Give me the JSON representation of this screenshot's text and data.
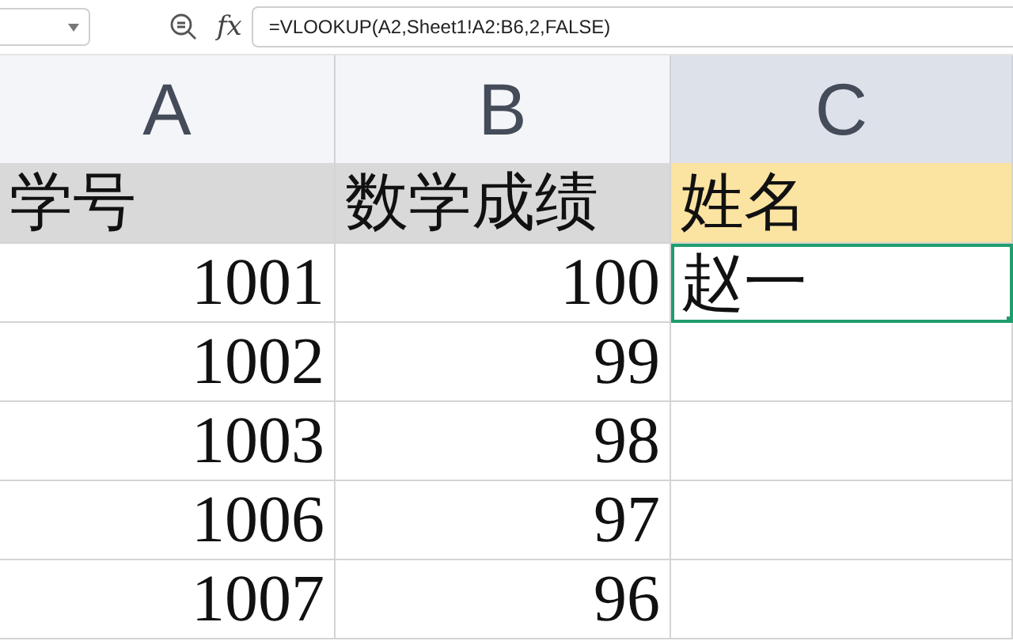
{
  "formula_bar": {
    "function_label": "fx",
    "formula": "=VLOOKUP(A2,Sheet1!A2:B6,2,FALSE)"
  },
  "columns": [
    {
      "label": "A",
      "selected": false
    },
    {
      "label": "B",
      "selected": false
    },
    {
      "label": "C",
      "selected": true
    }
  ],
  "rows": [
    [
      {
        "text": "学号",
        "kind": "text",
        "color": "#d9d9d9",
        "selected": false
      },
      {
        "text": "数学成绩",
        "kind": "text",
        "color": "#d9d9d9",
        "selected": false
      },
      {
        "text": "姓名",
        "kind": "text",
        "color": "#fbe3a1",
        "selected": false
      }
    ],
    [
      {
        "text": "1001",
        "kind": "number",
        "selected": false
      },
      {
        "text": "100",
        "kind": "number",
        "selected": false
      },
      {
        "text": "赵一",
        "kind": "text",
        "selected": true
      }
    ],
    [
      {
        "text": "1002",
        "kind": "number",
        "selected": false
      },
      {
        "text": "99",
        "kind": "number",
        "selected": false
      },
      {
        "selected": false
      }
    ],
    [
      {
        "text": "1003",
        "kind": "number",
        "selected": false
      },
      {
        "text": "98",
        "kind": "number",
        "selected": false
      },
      {
        "selected": false
      }
    ],
    [
      {
        "text": "1006",
        "kind": "number",
        "selected": false
      },
      {
        "text": "97",
        "kind": "number",
        "selected": false
      },
      {
        "selected": false
      }
    ],
    [
      {
        "text": "1007",
        "kind": "number",
        "selected": false
      },
      {
        "text": "96",
        "kind": "number",
        "selected": false
      },
      {
        "selected": false
      }
    ]
  ]
}
